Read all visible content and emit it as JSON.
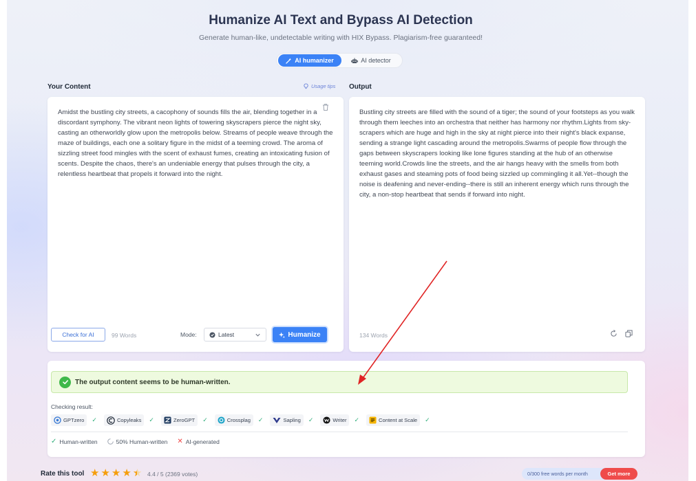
{
  "header": {
    "title": "Humanize AI Text and Bypass AI Detection",
    "subtitle": "Generate human-like, undetectable writing with HIX Bypass. Plagiarism-free guaranteed!"
  },
  "tabs": [
    {
      "label": "AI humanizer",
      "active": true,
      "icon": "wand-icon"
    },
    {
      "label": "AI detector",
      "active": false,
      "icon": "robot-icon"
    }
  ],
  "input_panel": {
    "label": "Your Content",
    "usage_tips": "Usage tips",
    "text": "Amidst the bustling city streets, a cacophony of sounds fills the air, blending together in a discordant symphony. The vibrant neon lights of towering skyscrapers pierce the night sky, casting an otherworldly glow upon the metropolis below. Streams of people weave through the maze of buildings, each one a solitary figure in the midst of a teeming crowd. The aroma of sizzling street food mingles with the scent of exhaust fumes, creating an intoxicating fusion of scents. Despite the chaos, there's an undeniable energy that pulses through the city, a relentless heartbeat that propels it forward into the night.",
    "check_button": "Check for AI",
    "word_count": "99 Words",
    "mode_label": "Mode:",
    "mode_value": "Latest",
    "humanize_button": "Humanize"
  },
  "output_panel": {
    "label": "Output",
    "text": "Bustling city streets are filled with the sound of a tiger; the sound of your footsteps as you walk through them leeches into an orchestra that neither has harmony nor rhythm.Lights from sky-scrapers which are huge and high in the sky at night pierce into their night's black expanse, sending a strange light cascading around the metropolis.Swarms of people flow through the gaps between skyscrapers looking like lone figures standing at the hub of an otherwise teeming world.Crowds line the streets, and the air hangs heavy with the smells from both exhaust gases and steaming pots of food being sizzled up commingling it all.Yet--though the noise is deafening and never-ending--there is still an inherent energy which runs through the city, a non-stop heartbeat that sends if forward into night.",
    "word_count": "134 Words"
  },
  "result": {
    "message": "The output content seems to be human-written.",
    "checking_label": "Checking result:",
    "detectors": [
      {
        "name": "GPTzero",
        "icon": "gptzero-icon",
        "color": "#3a7bd5"
      },
      {
        "name": "Copyleaks",
        "icon": "copyleaks-icon",
        "color": "#1f2937"
      },
      {
        "name": "ZeroGPT",
        "icon": "zerogpt-icon",
        "color": "#1e3a5f"
      },
      {
        "name": "Crossplag",
        "icon": "crossplag-icon",
        "color": "#22a6c9"
      },
      {
        "name": "Sapling",
        "icon": "sapling-icon",
        "color": "#2e3a8c"
      },
      {
        "name": "Writer",
        "icon": "writer-icon",
        "color": "#111111"
      },
      {
        "name": "Content at Scale",
        "icon": "content-at-scale-icon",
        "color": "#f5b400"
      }
    ],
    "legend": {
      "human": "Human-written",
      "half": "50% Human-written",
      "ai": "AI-generated"
    }
  },
  "footer": {
    "rate_label": "Rate this tool",
    "rating_value": 4.4,
    "rating_text": "4.4 / 5 (2369 votes)",
    "quota": "0/300 free words per month",
    "get_more": "Get more"
  },
  "colors": {
    "accent": "#3b82f6",
    "success": "#3fb84a",
    "annotation_arrow": "#e02424",
    "get_more": "#ef4b4b"
  }
}
